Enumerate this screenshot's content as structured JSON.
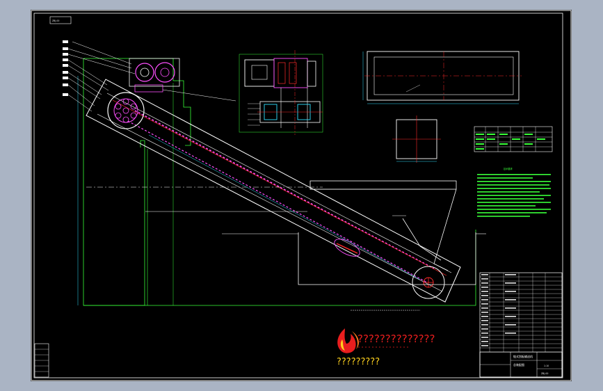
{
  "title_block": {
    "drawing_title": "链式刮板输送机",
    "scale": "1:10",
    "drawing_no": "ZBJ-00"
  },
  "drawing_label": "总装配图",
  "tech_requirements": {
    "title": "技术要求"
  },
  "placeholder": {
    "line1": "??????????????",
    "line2": "?????????"
  },
  "colors": {
    "frame": "#ffffff",
    "outline": "#39ff39",
    "centerline": "#ff2b2b",
    "chain": "#ff4fff",
    "dimension": "#2fe0ff",
    "part": "#ffffff",
    "yellow": "#ffd21e",
    "red": "#e81e1e",
    "sheet": "#000000",
    "backdrop": "#aab4c4"
  },
  "icons": {
    "logo": "flame-logo-icon"
  }
}
